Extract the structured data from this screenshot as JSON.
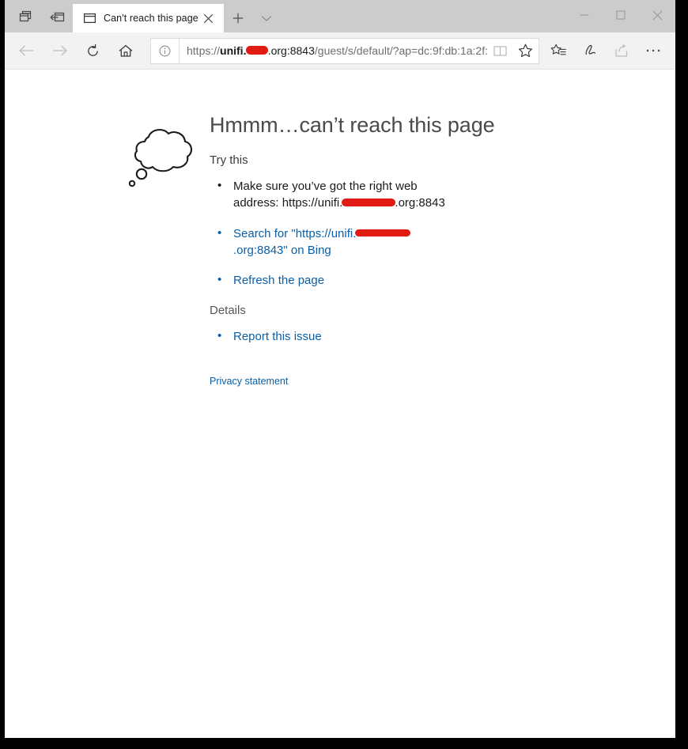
{
  "window": {
    "tabstrip": {
      "tab_preview_icon": "tab-preview-icon",
      "set_aside_icon": "set-tabs-aside-icon",
      "new_tab_label": "+",
      "tabs_menu_label": "⌄"
    },
    "tab": {
      "title": "Can't reach this page",
      "favicon": "window-glyph-icon",
      "close_label": "✕"
    },
    "controls": {
      "minimize_label": "—",
      "maximize_label": "☐",
      "close_label": "✕"
    }
  },
  "toolbar": {
    "back_label": "←",
    "forward_label": "→",
    "refresh_label": "↻",
    "home_label": "home-icon",
    "info_label": "ⓘ",
    "reading_view_label": "reading-view-icon",
    "favorite_label": "☆",
    "hub_label": "favorites-hub-icon",
    "web_note_label": "web-note-icon",
    "share_label": "share-icon",
    "settings_label": "…"
  },
  "address": {
    "prefix": "https://",
    "host_visible": "unifi.",
    "redacted": true,
    "host_suffix": ".org:8843",
    "path": "/guest/s/default/?ap=dc:9f:db:1a:2f:"
  },
  "error_page": {
    "icon": "thought-cloud-icon",
    "title": "Hmmm…can’t reach this page",
    "subheading": "Try this",
    "items": [
      {
        "name": "check-address",
        "type": "text",
        "text_before": "Make sure you’ve got the right web address: https://unifi.",
        "redacted": true,
        "text_after": ".org:8843"
      },
      {
        "name": "search-bing",
        "type": "link",
        "text_before": "Search for \"https://unifi.",
        "redacted": true,
        "text_after": ".org:8843\" on Bing"
      },
      {
        "name": "refresh-page",
        "type": "link",
        "text_before": "Refresh the page",
        "redacted": false,
        "text_after": ""
      }
    ],
    "details_heading": "Details",
    "report_link": "Report this issue",
    "privacy_link": "Privacy statement"
  },
  "colors": {
    "link": "#0a5fa8",
    "redaction": "#e01b13",
    "tabstrip": "#cccccc",
    "toolbar": "#f2f2f2",
    "frame": "#000000"
  }
}
